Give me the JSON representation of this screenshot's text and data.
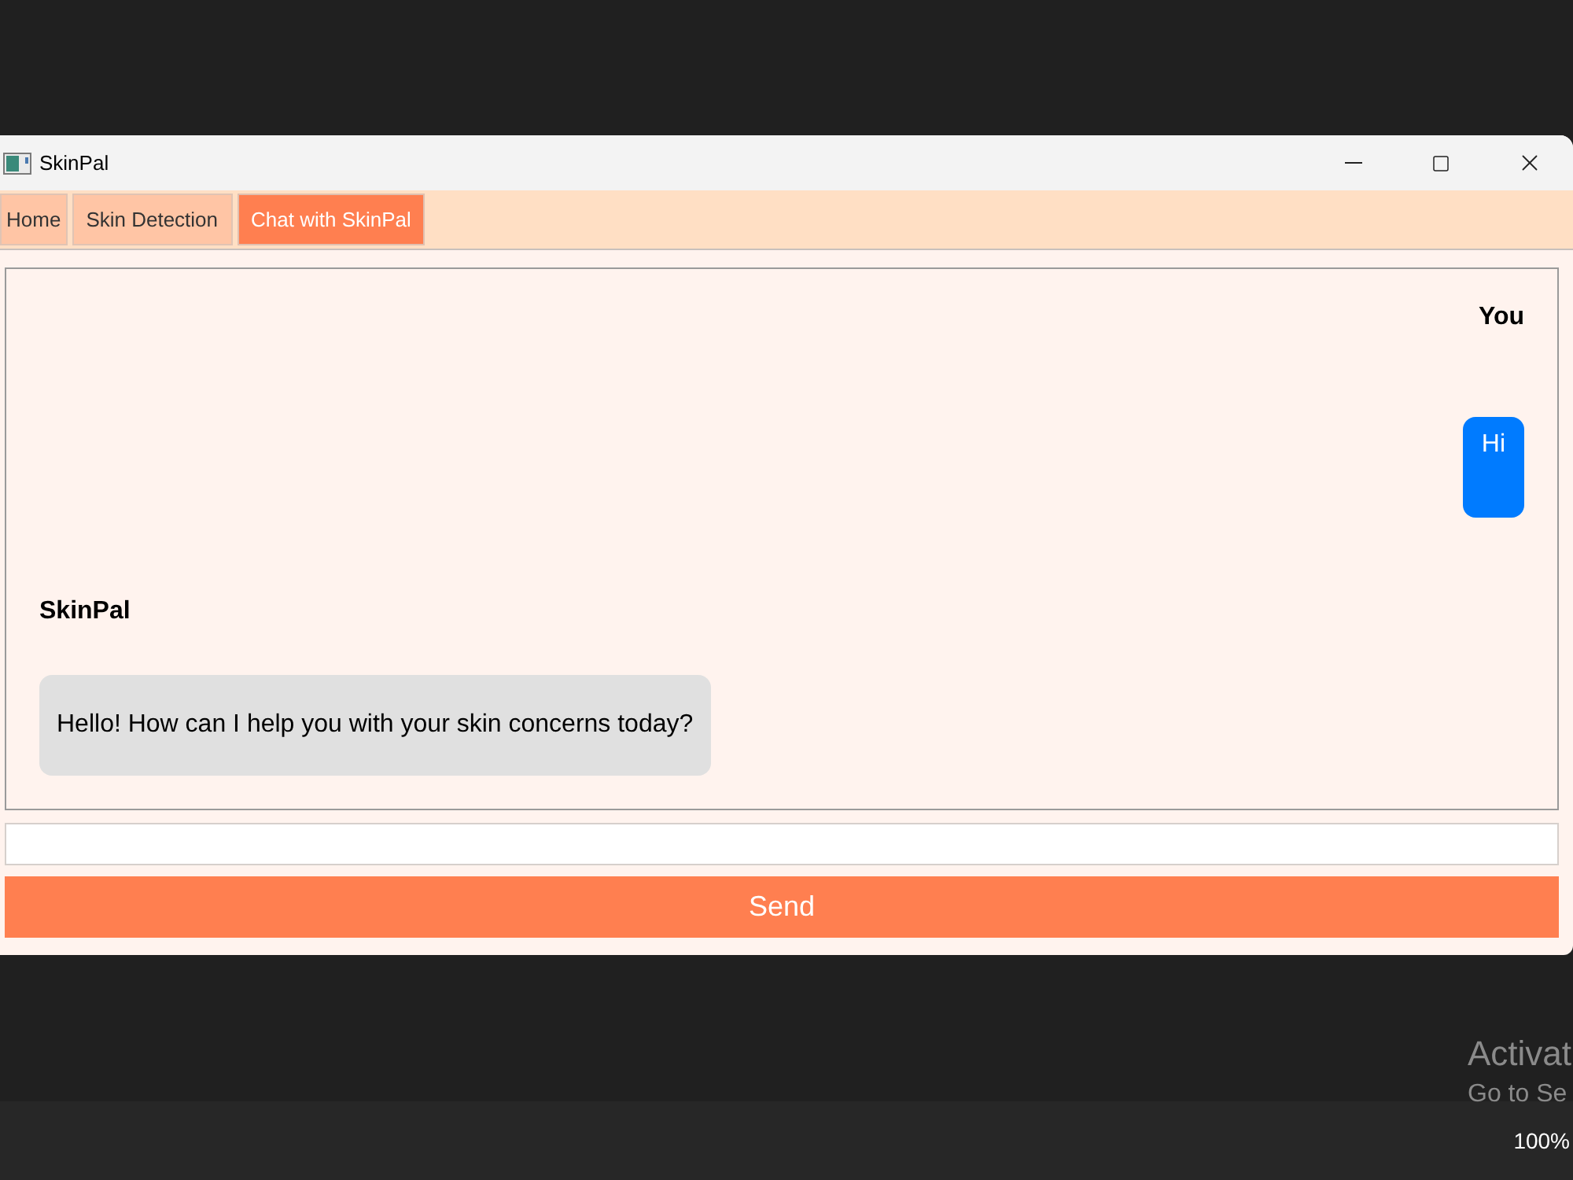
{
  "window": {
    "title": "SkinPal"
  },
  "tabs": [
    {
      "label": "Home",
      "selected": false
    },
    {
      "label": "Skin Detection",
      "selected": false
    },
    {
      "label": "Chat with SkinPal",
      "selected": true
    }
  ],
  "chat": {
    "messages": [
      {
        "kind": "user",
        "sender": "You",
        "text": "Hi"
      },
      {
        "kind": "bot",
        "sender": "SkinPal",
        "text": "Hello! How can I help you with your skin concerns today?"
      }
    ]
  },
  "send_button": {
    "label": "Send"
  },
  "desktop": {
    "watermark_lines": [
      "Activat",
      "Go to Se"
    ]
  },
  "taskbar": {
    "zoom": "100%"
  }
}
